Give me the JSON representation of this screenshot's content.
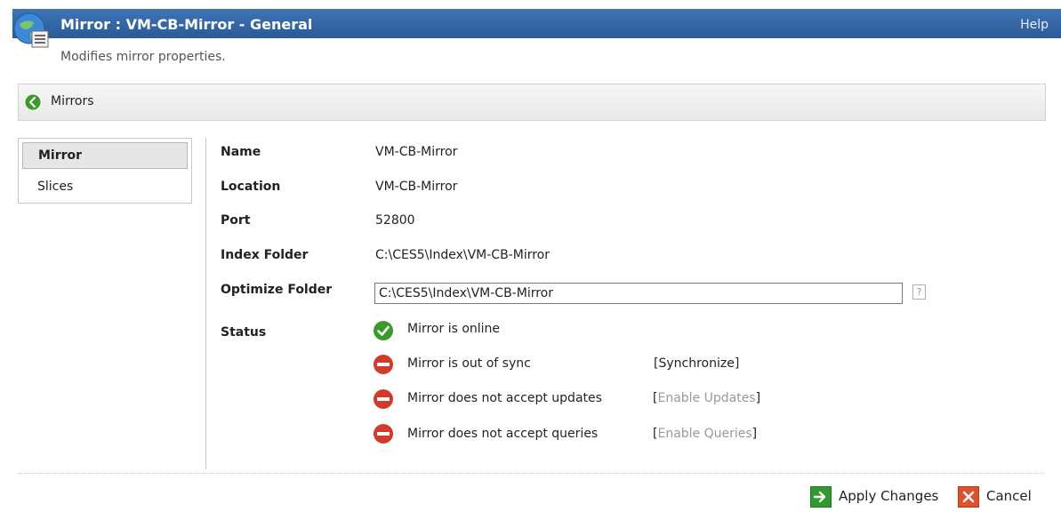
{
  "window": {
    "title": "Mirror : VM-CB-Mirror - General",
    "help_label": "Help",
    "subtitle": "Modifies mirror properties."
  },
  "breadcrumb": {
    "label": "Mirrors"
  },
  "sidebar": {
    "items": [
      {
        "label": "Mirror",
        "active": true
      },
      {
        "label": "Slices",
        "active": false
      }
    ]
  },
  "form": {
    "name": {
      "label": "Name",
      "value": "VM-CB-Mirror"
    },
    "location": {
      "label": "Location",
      "value": "VM-CB-Mirror"
    },
    "port": {
      "label": "Port",
      "value": "52800"
    },
    "index_folder": {
      "label": "Index Folder",
      "value": "C:\\CES5\\Index\\VM-CB-Mirror"
    },
    "optimize_folder": {
      "label": "Optimize Folder",
      "value": "C:\\CES5\\Index\\VM-CB-Mirror",
      "help_icon": "?"
    },
    "status_label": "Status"
  },
  "status": {
    "items": [
      {
        "icon": "check-circle-icon",
        "text": "Mirror is online",
        "action": ""
      },
      {
        "icon": "no-entry-icon",
        "text": "Mirror is out of sync",
        "action": "Synchronize",
        "action_enabled": true
      },
      {
        "icon": "no-entry-icon",
        "text": "Mirror does not accept updates",
        "action": "Enable Updates",
        "action_enabled": false
      },
      {
        "icon": "no-entry-icon",
        "text": "Mirror does not accept queries",
        "action": "Enable Queries",
        "action_enabled": false
      }
    ]
  },
  "footer": {
    "apply_label": "Apply Changes",
    "cancel_label": "Cancel"
  },
  "colors": {
    "title_bar": "#3f74b6",
    "ok_green": "#3a9a2a",
    "error_red": "#d23a2a",
    "apply_green": "#2f9a2f",
    "cancel_orange": "#e0502a"
  }
}
